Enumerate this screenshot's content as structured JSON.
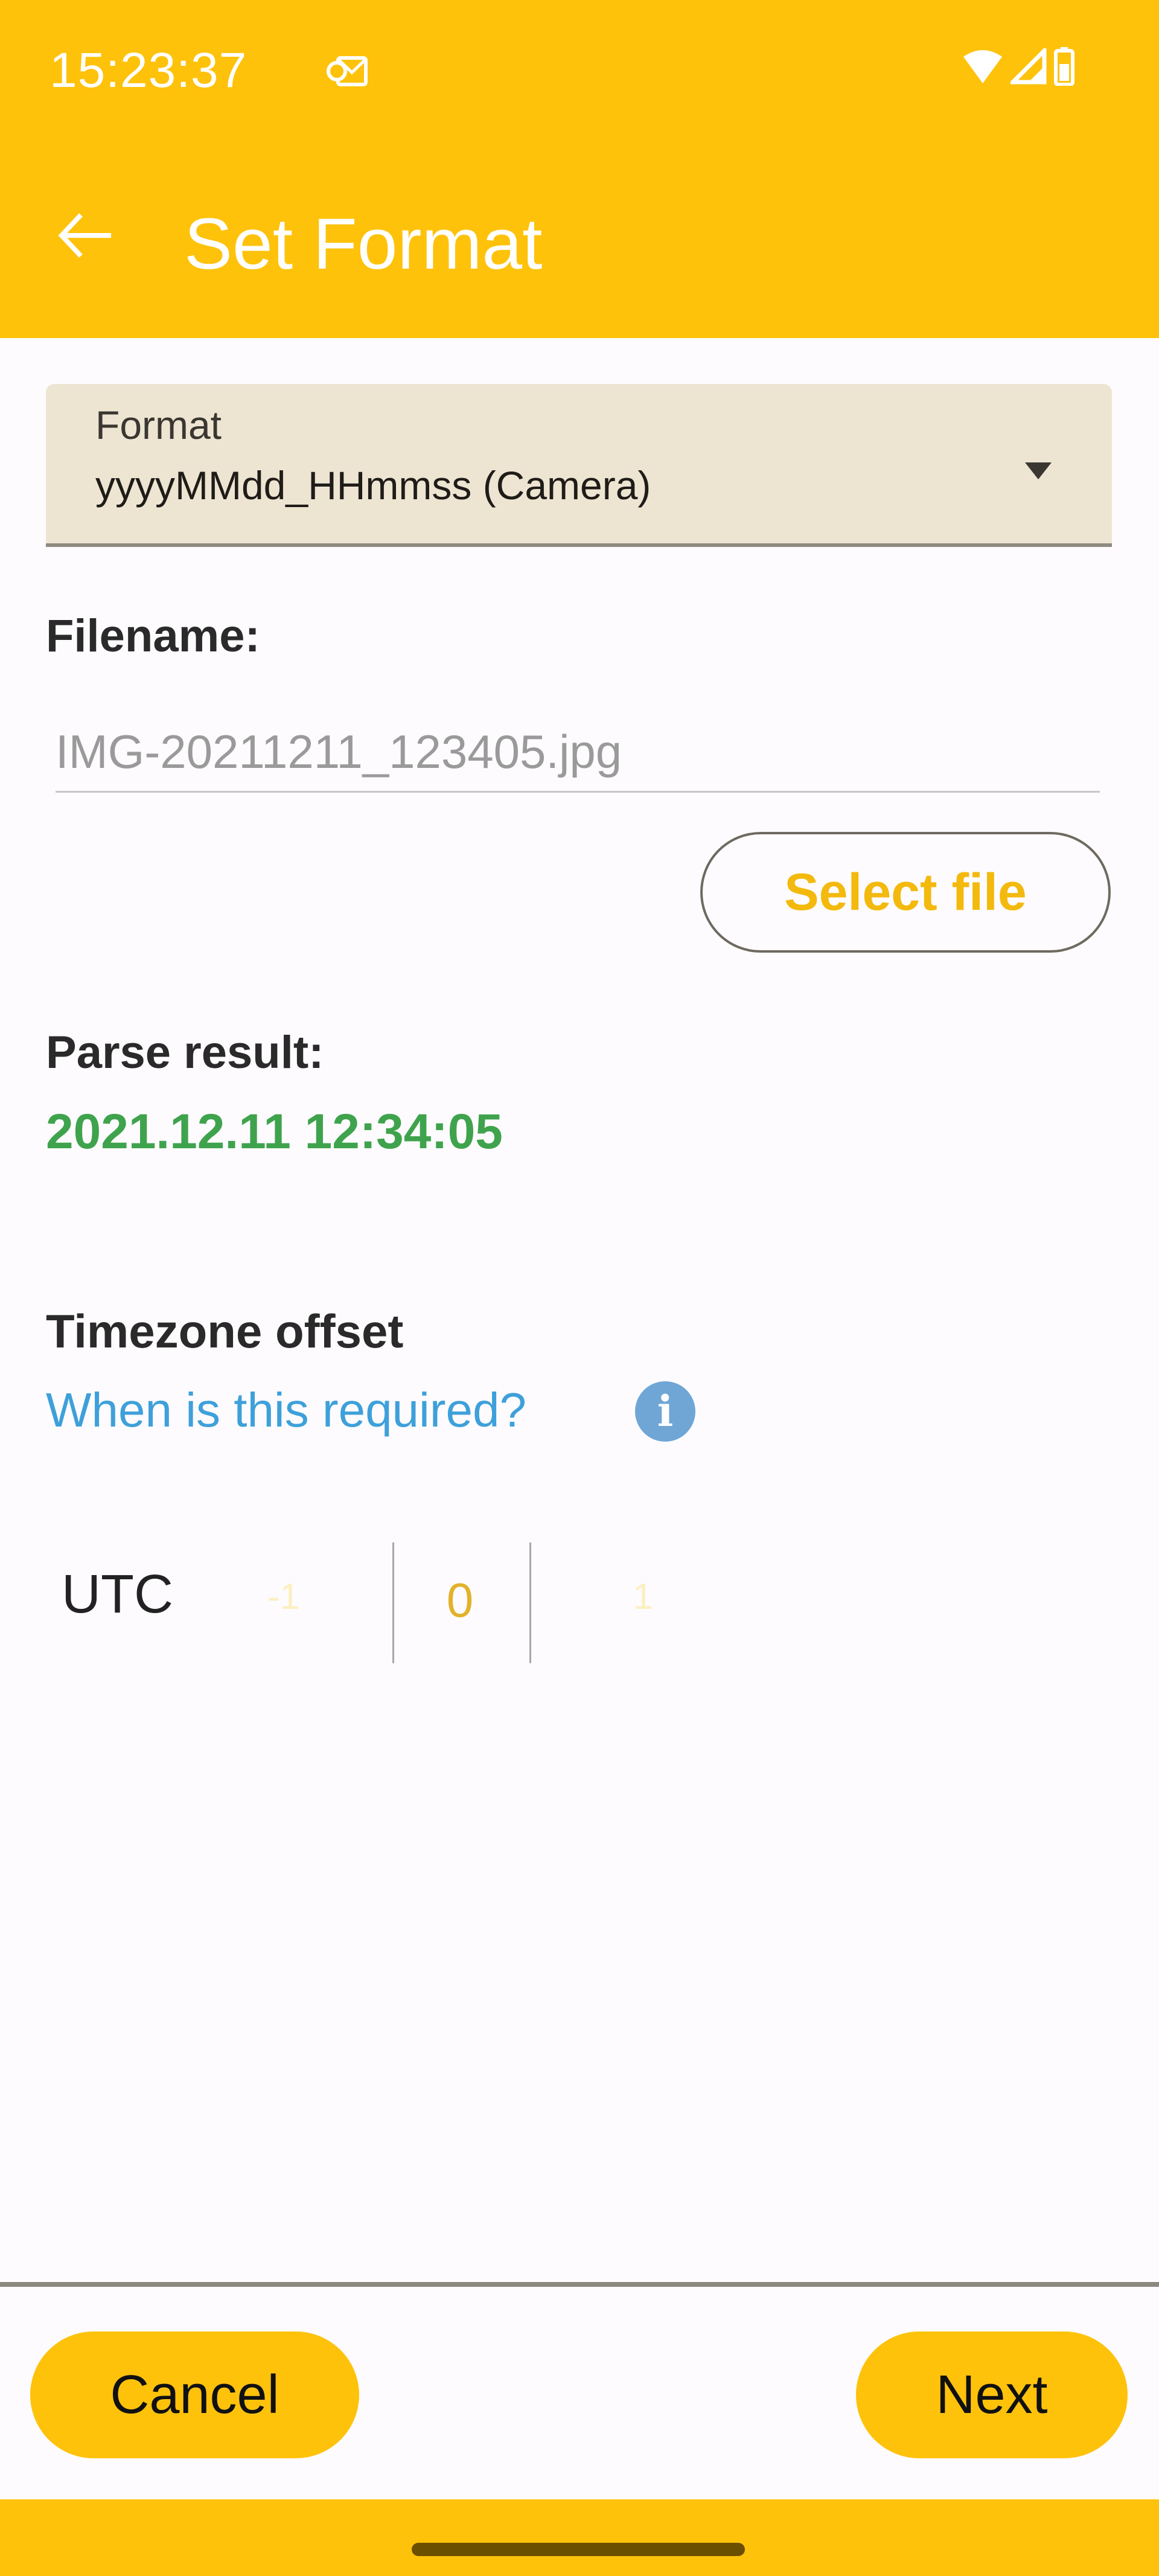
{
  "status_bar": {
    "time": "15:23:37",
    "notification_icon": "outlook-mail-icon",
    "right_icons": [
      "wifi-icon",
      "cell-signal-icon",
      "battery-icon"
    ]
  },
  "app_bar": {
    "back_icon": "arrow-left-icon",
    "title": "Set Format"
  },
  "format_dropdown": {
    "label": "Format",
    "selected_value": "yyyyMMdd_HHmmss (Camera)",
    "icon": "dropdown-arrow-icon"
  },
  "filename": {
    "label": "Filename:",
    "value": "IMG-20211211_123405.jpg",
    "select_file_label": "Select file"
  },
  "parse_result": {
    "label": "Parse result:",
    "value": "2021.12.11 12:34:05"
  },
  "timezone": {
    "label": "Timezone offset",
    "help_link": "When is this required?",
    "help_icon": "info-icon",
    "prefix": "UTC",
    "picker": {
      "previous": "-1",
      "selected": "0",
      "next": "1"
    }
  },
  "footer": {
    "cancel_label": "Cancel",
    "next_label": "Next"
  },
  "colors": {
    "accent": "#FEC20B",
    "success": "#3FA34D",
    "link": "#3EA0DA"
  }
}
